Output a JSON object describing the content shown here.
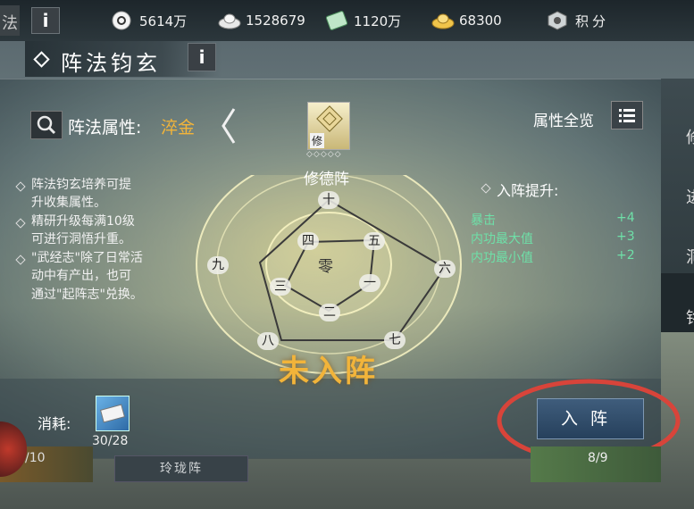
{
  "currency": {
    "gold": "5614万",
    "silver": "1528679",
    "tickets": "1120万",
    "coins": "68300",
    "points_label": "积分"
  },
  "corner_char": "法",
  "info_glyph": "i",
  "title": "阵法钧玄",
  "formation": {
    "attr_label": "阵法属性:",
    "attr_value": "淬金",
    "name": "修德阵",
    "thumb_char": "修",
    "status": "未入阵",
    "center_char": "零",
    "nodes": [
      "十",
      "四",
      "五",
      "九",
      "三",
      "一",
      "六",
      "二",
      "八",
      "七"
    ]
  },
  "overview_label": "属性全览",
  "description": [
    "阵法钧玄培养可提",
    "升收集属性。",
    "精研升级每满10级",
    "可进行洞悟升重。",
    "\"武经志\"除了日常活",
    "动中有产出，也可",
    "通过\"起阵志\"兑换。"
  ],
  "boost": {
    "title": "入阵提升:",
    "stats": [
      {
        "name": "暴击",
        "value": "+4"
      },
      {
        "name": "内功最大值",
        "value": "+3"
      },
      {
        "name": "内功最小值",
        "value": "+2"
      }
    ]
  },
  "cost": {
    "label": "消耗:",
    "count": "30/28"
  },
  "enter_button": "入阵",
  "bottom": {
    "left_count": "/10",
    "tab_label": "玲珑阵",
    "right_count": "8/9"
  },
  "side_chars": [
    "修",
    "进",
    "洞",
    "铭"
  ],
  "colors": {
    "accent_gold": "#f2b43a",
    "stat_green": "#6ee0a8",
    "highlight_red": "#d8443a"
  }
}
